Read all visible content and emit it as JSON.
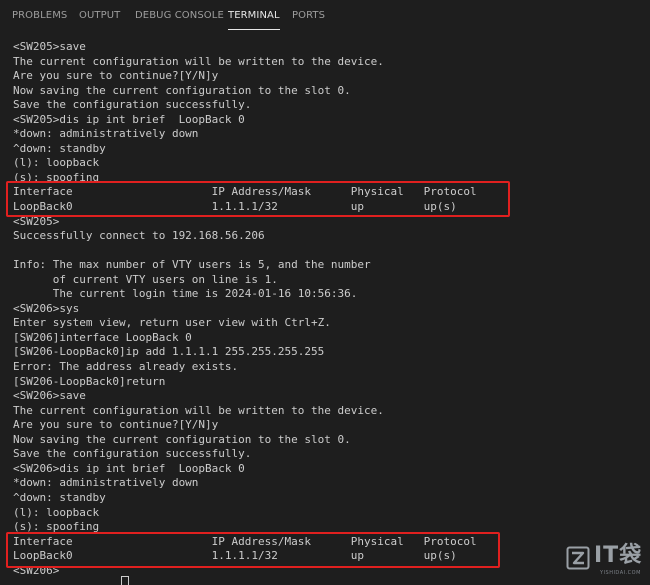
{
  "tabs": [
    {
      "label": "PROBLEMS",
      "active": false
    },
    {
      "label": "OUTPUT",
      "active": false
    },
    {
      "label": "DEBUG CONSOLE",
      "active": false
    },
    {
      "label": "TERMINAL",
      "active": true
    },
    {
      "label": "PORTS",
      "active": false
    }
  ],
  "terminal": {
    "lines": [
      "<SW205>save",
      "The current configuration will be written to the device.",
      "Are you sure to continue?[Y/N]y",
      "Now saving the current configuration to the slot 0.",
      "Save the configuration successfully.",
      "<SW205>dis ip int brief  LoopBack 0",
      "*down: administratively down",
      "^down: standby",
      "(l): loopback",
      "(s): spoofing",
      "Interface                     IP Address/Mask      Physical   Protocol",
      "LoopBack0                     1.1.1.1/32           up         up(s)",
      "<SW205>",
      "Successfully connect to 192.168.56.206",
      "",
      "Info: The max number of VTY users is 5, and the number",
      "      of current VTY users on line is 1.",
      "      The current login time is 2024-01-16 10:56:36.",
      "<SW206>sys",
      "Enter system view, return user view with Ctrl+Z.",
      "[SW206]interface LoopBack 0",
      "[SW206-LoopBack0]ip add 1.1.1.1 255.255.255.255",
      "Error: The address already exists.",
      "[SW206-LoopBack0]return",
      "<SW206>save",
      "The current configuration will be written to the device.",
      "Are you sure to continue?[Y/N]y",
      "Now saving the current configuration to the slot 0.",
      "Save the configuration successfully.",
      "<SW206>dis ip int brief  LoopBack 0",
      "*down: administratively down",
      "^down: standby",
      "(l): loopback",
      "(s): spoofing",
      "Interface                     IP Address/Mask      Physical   Protocol",
      "LoopBack0                     1.1.1.1/32           up         up(s)",
      "<SW206>"
    ]
  },
  "watermark": {
    "text": "IT袋",
    "sub": "YISHIDAI.COM"
  },
  "colors": {
    "background": "#1e1e1e",
    "text": "#cccccc",
    "highlight": "#e0201f",
    "tab_active": "#e7e7e7",
    "tab_inactive": "#9d9d9d"
  }
}
